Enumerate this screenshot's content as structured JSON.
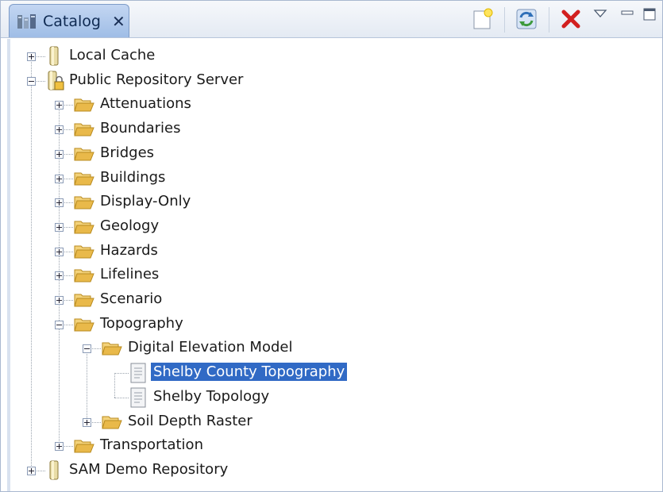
{
  "window": {
    "tab_title": "Catalog",
    "tab_icon": "catalog-icon",
    "close_glyph": "✕"
  },
  "toolbar": {
    "buttons": [
      {
        "name": "new-item-button",
        "icon": "new-document-icon"
      },
      {
        "name": "refresh-button",
        "icon": "refresh-icon"
      },
      {
        "name": "remove-button",
        "icon": "red-x-icon"
      },
      {
        "name": "view-menu-button",
        "icon": "triangle-down-icon"
      },
      {
        "name": "minimize-button",
        "icon": "minimize-icon"
      },
      {
        "name": "maximize-button",
        "icon": "maximize-icon"
      }
    ]
  },
  "tree": [
    {
      "label": "Local Cache",
      "depth": 0,
      "expander": "plus",
      "icon": "repository-cylinder-icon"
    },
    {
      "label": "Public Repository Server",
      "depth": 0,
      "expander": "minus",
      "icon": "repository-locked-icon"
    },
    {
      "label": "Attenuations",
      "depth": 1,
      "expander": "plus",
      "icon": "folder-open-icon"
    },
    {
      "label": "Boundaries",
      "depth": 1,
      "expander": "plus",
      "icon": "folder-open-icon"
    },
    {
      "label": "Bridges",
      "depth": 1,
      "expander": "plus",
      "icon": "folder-open-icon"
    },
    {
      "label": "Buildings",
      "depth": 1,
      "expander": "plus",
      "icon": "folder-open-icon"
    },
    {
      "label": "Display-Only",
      "depth": 1,
      "expander": "plus",
      "icon": "folder-open-icon"
    },
    {
      "label": "Geology",
      "depth": 1,
      "expander": "plus",
      "icon": "folder-open-icon"
    },
    {
      "label": "Hazards",
      "depth": 1,
      "expander": "plus",
      "icon": "folder-open-icon"
    },
    {
      "label": "Lifelines",
      "depth": 1,
      "expander": "plus",
      "icon": "folder-open-icon"
    },
    {
      "label": "Scenario",
      "depth": 1,
      "expander": "plus",
      "icon": "folder-open-icon"
    },
    {
      "label": "Topography",
      "depth": 1,
      "expander": "minus",
      "icon": "folder-open-icon"
    },
    {
      "label": "Digital Elevation Model",
      "depth": 2,
      "expander": "minus",
      "icon": "folder-open-icon"
    },
    {
      "label": "Shelby County Topography",
      "depth": 3,
      "expander": "none",
      "icon": "document-icon",
      "selected": true
    },
    {
      "label": "Shelby Topology",
      "depth": 3,
      "expander": "none",
      "icon": "document-icon"
    },
    {
      "label": "Soil Depth Raster",
      "depth": 2,
      "expander": "plus",
      "icon": "folder-open-icon"
    },
    {
      "label": "Transportation",
      "depth": 1,
      "expander": "plus",
      "icon": "folder-open-icon"
    },
    {
      "label": "SAM Demo Repository",
      "depth": 0,
      "expander": "plus",
      "icon": "repository-cylinder-icon"
    }
  ],
  "colors": {
    "selection": "#316ac5",
    "tab_active": "#9fbde6",
    "folder": "#e9b94a",
    "delete": "#d21f1f"
  }
}
